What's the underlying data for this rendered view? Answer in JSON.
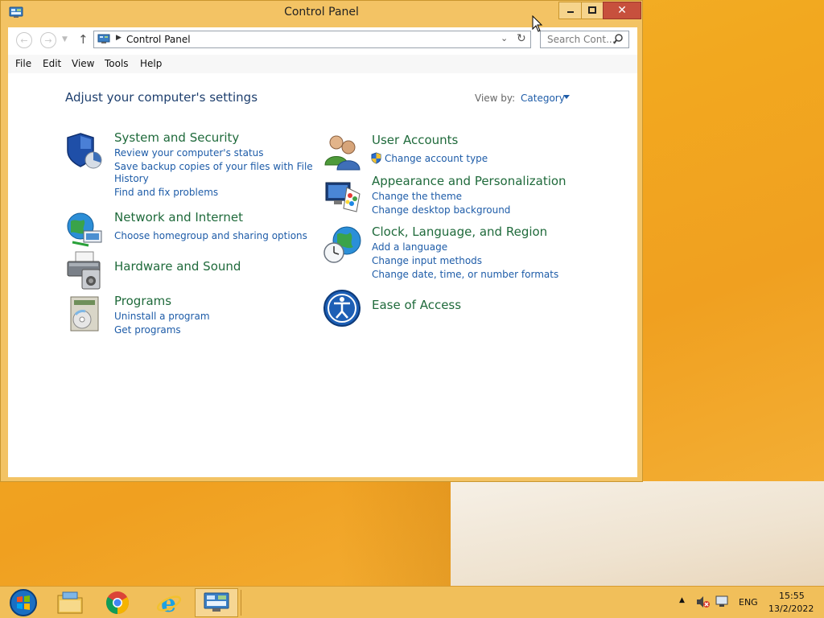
{
  "window": {
    "title": "Control Panel",
    "minimize_icon": "minimize-icon",
    "maximize_icon": "maximize-icon",
    "close_icon": "close-icon",
    "close_glyph": "✕"
  },
  "address": {
    "path_label": "Control Panel",
    "search_placeholder": "Search Cont...",
    "back_glyph": "←",
    "forward_glyph": "→",
    "up_glyph": "↑"
  },
  "menu": {
    "items": [
      "File",
      "Edit",
      "View",
      "Tools",
      "Help"
    ]
  },
  "main": {
    "heading": "Adjust your computer's settings",
    "view_by_label": "View by:",
    "view_by_value": "Category",
    "left_categories": [
      {
        "title": "System and Security",
        "icon": "shield-icon",
        "links": [
          "Review your computer's status",
          "Save backup copies of your files with File",
          "History",
          "Find and fix problems"
        ]
      },
      {
        "title": "Network and Internet",
        "icon": "network-globe-icon",
        "links": [
          "Choose homegroup and sharing options"
        ]
      },
      {
        "title": "Hardware and Sound",
        "icon": "printer-speaker-icon",
        "links": []
      },
      {
        "title": "Programs",
        "icon": "programs-disc-icon",
        "links": [
          "Uninstall a program",
          "Get programs"
        ]
      }
    ],
    "right_categories": [
      {
        "title": "User Accounts",
        "icon": "users-icon",
        "links": [
          "Change account type"
        ]
      },
      {
        "title": "Appearance and Personalization",
        "icon": "monitor-palette-icon",
        "links": [
          "Change the theme",
          "Change desktop background"
        ]
      },
      {
        "title": "Clock, Language, and Region",
        "icon": "clock-globe-icon",
        "links": [
          "Add a language",
          "Change input methods",
          "Change date, time, or number formats"
        ]
      },
      {
        "title": "Ease of Access",
        "icon": "ease-of-access-icon",
        "links": []
      }
    ]
  },
  "taskbar": {
    "pinned": [
      "start-orb-icon",
      "file-explorer-icon",
      "chrome-icon",
      "internet-explorer-icon",
      "control-panel-icon"
    ],
    "tray": {
      "language": "ENG",
      "time": "15:55",
      "date": "13/2/2022"
    }
  },
  "colors": {
    "window_frame": "#f3c364",
    "close_button": "#c7503d",
    "category_title": "#1f6a3b",
    "link": "#1e5ca8",
    "heading": "#1e3f6e"
  }
}
